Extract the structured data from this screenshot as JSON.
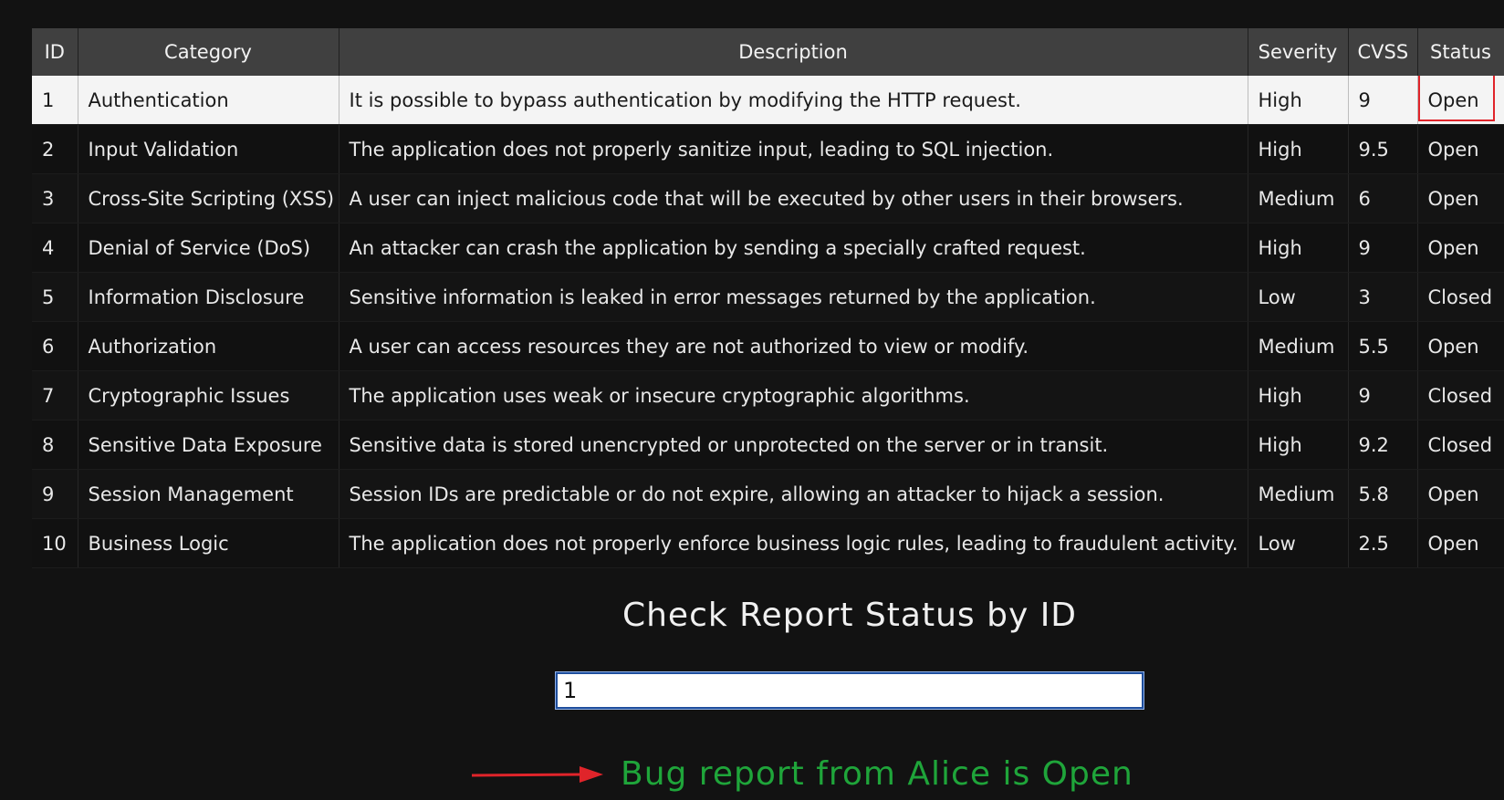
{
  "table": {
    "headers": [
      "ID",
      "Category",
      "Description",
      "Severity",
      "CVSS",
      "Status"
    ],
    "rows": [
      {
        "id": "1",
        "category": "Authentication",
        "description": "It is possible to bypass authentication by modifying the HTTP request.",
        "severity": "High",
        "cvss": "9",
        "status": "Open"
      },
      {
        "id": "2",
        "category": "Input Validation",
        "description": "The application does not properly sanitize input, leading to SQL injection.",
        "severity": "High",
        "cvss": "9.5",
        "status": "Open"
      },
      {
        "id": "3",
        "category": "Cross-Site Scripting (XSS)",
        "description": "A user can inject malicious code that will be executed by other users in their browsers.",
        "severity": "Medium",
        "cvss": "6",
        "status": "Open"
      },
      {
        "id": "4",
        "category": "Denial of Service (DoS)",
        "description": "An attacker can crash the application by sending a specially crafted request.",
        "severity": "High",
        "cvss": "9",
        "status": "Open"
      },
      {
        "id": "5",
        "category": "Information Disclosure",
        "description": "Sensitive information is leaked in error messages returned by the application.",
        "severity": "Low",
        "cvss": "3",
        "status": "Closed"
      },
      {
        "id": "6",
        "category": "Authorization",
        "description": "A user can access resources they are not authorized to view or modify.",
        "severity": "Medium",
        "cvss": "5.5",
        "status": "Open"
      },
      {
        "id": "7",
        "category": "Cryptographic Issues",
        "description": "The application uses weak or insecure cryptographic algorithms.",
        "severity": "High",
        "cvss": "9",
        "status": "Closed"
      },
      {
        "id": "8",
        "category": "Sensitive Data Exposure",
        "description": "Sensitive data is stored unencrypted or unprotected on the server or in transit.",
        "severity": "High",
        "cvss": "9.2",
        "status": "Closed"
      },
      {
        "id": "9",
        "category": "Session Management",
        "description": "Session IDs are predictable or do not expire, allowing an attacker to hijack a session.",
        "severity": "Medium",
        "cvss": "5.8",
        "status": "Open"
      },
      {
        "id": "10",
        "category": "Business Logic",
        "description": "The application does not properly enforce business logic rules, leading to fraudulent activity.",
        "severity": "Low",
        "cvss": "2.5",
        "status": "Open"
      }
    ]
  },
  "check": {
    "title": "Check Report Status by ID",
    "input_value": "1",
    "result": "Bug report from Alice is Open"
  },
  "colors": {
    "result_text": "#1fa53a",
    "arrow": "#e0242a",
    "highlight_box": "#e0242a",
    "header_bg": "#404040",
    "page_bg": "#121212"
  },
  "icons": {
    "arrow": "right-arrow-icon"
  }
}
